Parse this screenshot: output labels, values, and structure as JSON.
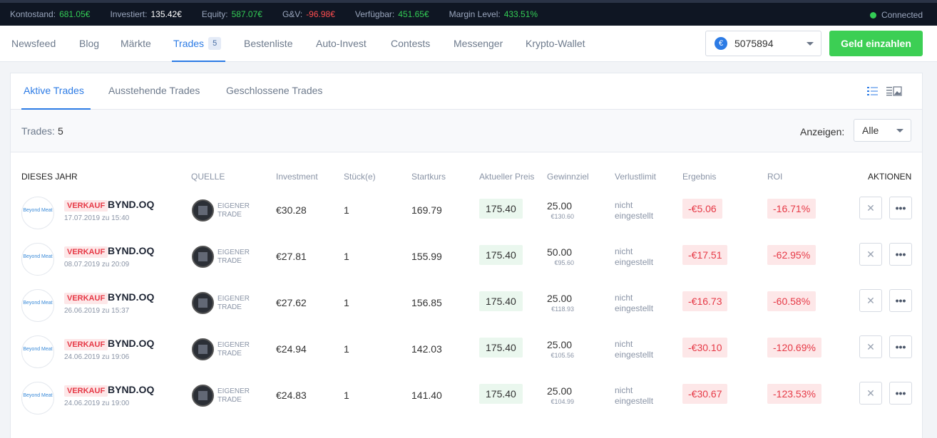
{
  "topbar": {
    "stats": [
      {
        "label": "Kontostand:",
        "value": "681.05€",
        "color": "green"
      },
      {
        "label": "Investiert:",
        "value": "135.42€",
        "color": "white"
      },
      {
        "label": "Equity:",
        "value": "587.07€",
        "color": "green"
      },
      {
        "label": "G&V:",
        "value": "-96.98€",
        "color": "red"
      },
      {
        "label": "Verfügbar:",
        "value": "451.65€",
        "color": "green"
      },
      {
        "label": "Margin Level:",
        "value": "433.51%",
        "color": "green"
      }
    ],
    "connection_status": "Connected"
  },
  "nav": {
    "items": [
      "Newsfeed",
      "Blog",
      "Märkte",
      "Trades",
      "Bestenliste",
      "Auto-Invest",
      "Contests",
      "Messenger",
      "Krypto-Wallet"
    ],
    "active": "Trades",
    "trades_badge": "5",
    "account_currency_symbol": "€",
    "account_number": "5075894",
    "deposit_label": "Geld einzahlen"
  },
  "tabs": [
    "Aktive Trades",
    "Ausstehende Trades",
    "Geschlossene Trades"
  ],
  "active_tab": "Aktive Trades",
  "summary": {
    "label": "Trades:",
    "count": "5",
    "show_label": "Anzeigen:",
    "show_value": "Alle"
  },
  "table": {
    "headers": {
      "section": "DIESES JAHR",
      "source": "QUELLE",
      "investment": "Investment",
      "units": "Stück(e)",
      "start_price": "Startkurs",
      "current_price": "Aktueller Preis",
      "take_profit": "Gewinnziel",
      "stop_loss": "Verlustlimit",
      "result": "Ergebnis",
      "roi": "ROI",
      "actions": "AKTIONEN"
    },
    "rows": [
      {
        "logo": "Beyond Meat",
        "side": "VERKAUF",
        "symbol": "BYND.OQ",
        "date": "17.07.2019 zu 15:40",
        "source": "EIGENER TRADE",
        "investment": "€30.28",
        "units": "1",
        "start_price": "169.79",
        "current_price": "175.40",
        "take_profit": "25.00",
        "take_profit_eur": "€130.60",
        "stop_loss": "nicht eingestellt",
        "result": "-€5.06",
        "roi": "-16.71%"
      },
      {
        "logo": "Beyond Meat",
        "side": "VERKAUF",
        "symbol": "BYND.OQ",
        "date": "08.07.2019 zu 20:09",
        "source": "EIGENER TRADE",
        "investment": "€27.81",
        "units": "1",
        "start_price": "155.99",
        "current_price": "175.40",
        "take_profit": "50.00",
        "take_profit_eur": "€95.60",
        "stop_loss": "nicht eingestellt",
        "result": "-€17.51",
        "roi": "-62.95%"
      },
      {
        "logo": "Beyond Meat",
        "side": "VERKAUF",
        "symbol": "BYND.OQ",
        "date": "26.06.2019 zu 15:37",
        "source": "EIGENER TRADE",
        "investment": "€27.62",
        "units": "1",
        "start_price": "156.85",
        "current_price": "175.40",
        "take_profit": "25.00",
        "take_profit_eur": "€118.93",
        "stop_loss": "nicht eingestellt",
        "result": "-€16.73",
        "roi": "-60.58%"
      },
      {
        "logo": "Beyond Meat",
        "side": "VERKAUF",
        "symbol": "BYND.OQ",
        "date": "24.06.2019 zu 19:06",
        "source": "EIGENER TRADE",
        "investment": "€24.94",
        "units": "1",
        "start_price": "142.03",
        "current_price": "175.40",
        "take_profit": "25.00",
        "take_profit_eur": "€105.56",
        "stop_loss": "nicht eingestellt",
        "result": "-€30.10",
        "roi": "-120.69%"
      },
      {
        "logo": "Beyond Meat",
        "side": "VERKAUF",
        "symbol": "BYND.OQ",
        "date": "24.06.2019 zu 19:00",
        "source": "EIGENER TRADE",
        "investment": "€24.83",
        "units": "1",
        "start_price": "141.40",
        "current_price": "175.40",
        "take_profit": "25.00",
        "take_profit_eur": "€104.99",
        "stop_loss": "nicht eingestellt",
        "result": "-€30.67",
        "roi": "-123.53%"
      }
    ]
  },
  "icons": {
    "close": "close-icon",
    "more": "more-icon",
    "list_view": "list-view-icon",
    "card_view": "card-view-icon"
  }
}
